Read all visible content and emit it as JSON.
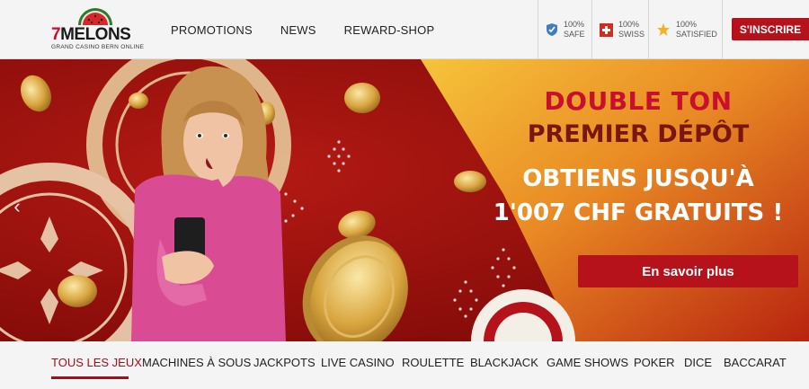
{
  "header": {
    "logo": {
      "seven": "7",
      "name": "MELONS",
      "tagline": "GRAND CASINO BERN ONLINE"
    },
    "nav": [
      {
        "label": "PROMOTIONS"
      },
      {
        "label": "NEWS"
      },
      {
        "label": "REWARD-SHOP"
      }
    ],
    "badges": [
      {
        "icon": "shield-icon",
        "line1": "100%",
        "line2": "SAFE"
      },
      {
        "icon": "swiss-flag-icon",
        "line1": "100%",
        "line2": "SWISS"
      },
      {
        "icon": "star-icon",
        "line1": "100%",
        "line2": "SATISFIED"
      }
    ],
    "signup_label": "S'INSCRIRE"
  },
  "banner": {
    "headline_1": "DOUBLE TON",
    "headline_2": "PREMIER DÉPÔT",
    "offer_1": "OBTIENS JUSQU'À",
    "offer_2": "1'007 CHF GRATUITS !",
    "cta_label": "En savoir plus",
    "prev_arrow": "‹"
  },
  "categories": [
    {
      "label": "TOUS LES JEUX",
      "active": true
    },
    {
      "label": "MACHINES À SOUS"
    },
    {
      "label": "JACKPOTS"
    },
    {
      "label": "LIVE CASINO"
    },
    {
      "label": "ROULETTE"
    },
    {
      "label": "BLACKJACK"
    },
    {
      "label": "GAME SHOWS"
    },
    {
      "label": "POKER"
    },
    {
      "label": "DICE"
    },
    {
      "label": "BACCARAT"
    }
  ],
  "colors": {
    "brand_red": "#b5121b",
    "active_red": "#a01018",
    "banner_red": "#9b0f0c",
    "banner_yellow": "#f2b731",
    "headline_red": "#c8102e"
  }
}
